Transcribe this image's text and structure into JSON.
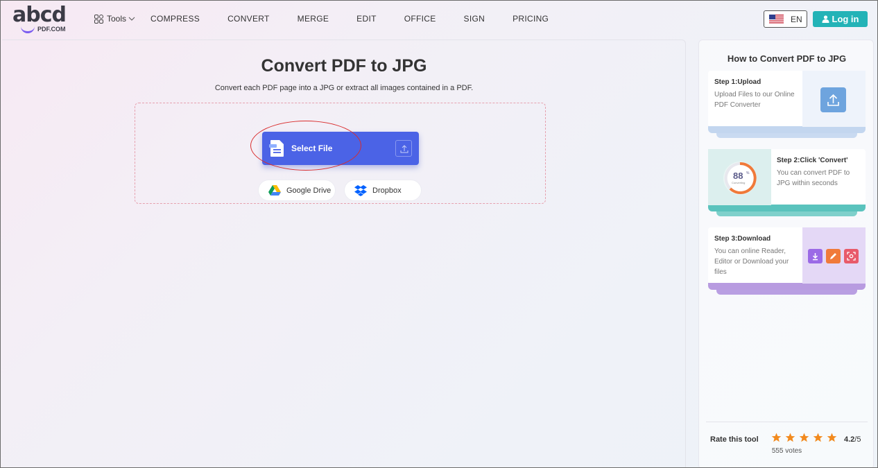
{
  "header": {
    "logo_word": "abcd",
    "logo_sub": "PDF.COM",
    "tools_label": "Tools",
    "nav": [
      "COMPRESS",
      "CONVERT",
      "MERGE",
      "EDIT",
      "OFFICE",
      "SIGN",
      "PRICING"
    ],
    "lang": "EN",
    "login": "Log in"
  },
  "main": {
    "title": "Convert PDF to JPG",
    "subtitle": "Convert each PDF page into a JPG or extract all images contained in a PDF.",
    "select_file": "Select File",
    "sources": [
      "Google Drive",
      "Dropbox"
    ]
  },
  "side": {
    "title": "How to Convert PDF to JPG",
    "steps": [
      {
        "heading": "Step 1:Upload",
        "desc": "Upload Files to our Online PDF Converter"
      },
      {
        "heading": "Step 2:Click 'Convert'",
        "desc": "You can convert PDF to JPG within seconds"
      },
      {
        "heading": "Step 3:Download",
        "desc": "You can online Reader, Editor or Download your files"
      }
    ],
    "progress": {
      "value": 88,
      "unit": "%",
      "label": "Converting"
    },
    "rating": {
      "label": "Rate this tool",
      "score": "4.2",
      "of": "/5",
      "votes": "555 votes",
      "stars": 5
    }
  },
  "colors": {
    "accent_blue": "#4b63e6",
    "login_teal": "#23b3b7",
    "star_orange": "#f28a1e",
    "annotation_red": "#d92b2b"
  },
  "icons": [
    "tools-grid-icon",
    "chevron-down-icon",
    "us-flag-icon",
    "user-icon",
    "file-icon",
    "upload-icon",
    "google-drive-icon",
    "dropbox-icon",
    "star-icon",
    "download-icon",
    "edit-icon",
    "ocr-icon"
  ]
}
